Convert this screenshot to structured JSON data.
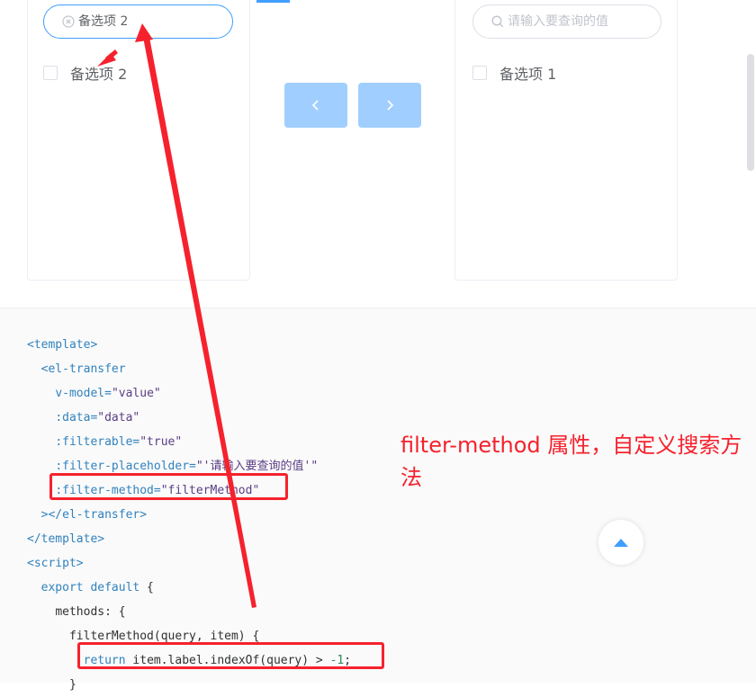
{
  "transfer": {
    "left": {
      "filter_value": "备选项 2",
      "items": [
        {
          "label": "备选项 2"
        }
      ]
    },
    "right": {
      "filter_placeholder": "请输入要查询的值",
      "items": [
        {
          "label": "备选项 1"
        }
      ]
    },
    "buttons": {
      "prev_icon": "chevron-left-icon",
      "next_icon": "chevron-right-icon"
    }
  },
  "code": {
    "line1": "<template>",
    "line2": "  <el-transfer",
    "line3_attr": "v-model=",
    "line3_val": "\"value\"",
    "line4_attr": ":data=",
    "line4_val": "\"data\"",
    "line5_attr": ":filterable=",
    "line5_val": "\"true\"",
    "line6_attr": ":filter-placeholder=",
    "line6_val": "\"'请输入要查询的值'\"",
    "line7_attr": ":filter-method=",
    "line7_val": "\"filterMethod\"",
    "line8": "></el-transfer>",
    "line9": "</template>",
    "line10": "<script>",
    "line11_kw": "export default",
    "line11_rest": " {",
    "line12": "methods: {",
    "line13": "filterMethod(query, item) {",
    "line14_kw": "return",
    "line14_mid": " item.label.indexOf(query) > ",
    "line14_num": "-1",
    "line14_end": ";",
    "line15": "}"
  },
  "annotation": {
    "text": "filter-method 属性，自定义搜索方法",
    "color": "#f5222d"
  },
  "colors": {
    "primary": "#409eff",
    "button_disabled": "#a0cfff",
    "annotation": "#f5222d"
  }
}
